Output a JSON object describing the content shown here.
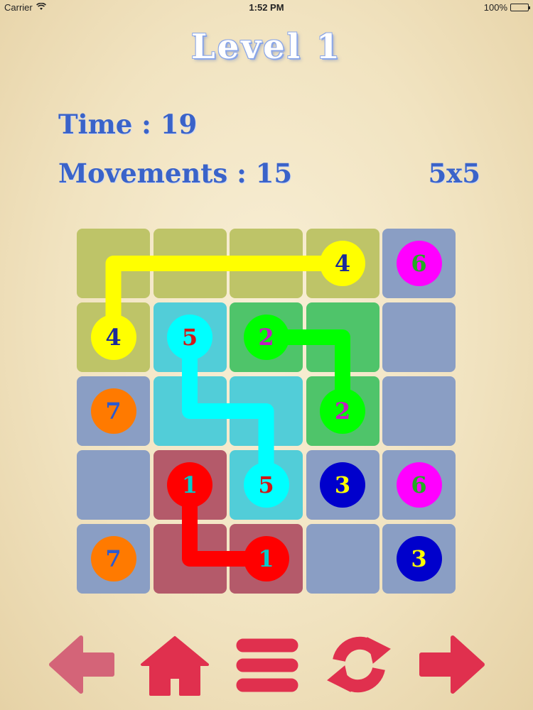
{
  "status_bar": {
    "carrier": "Carrier",
    "time": "1:52 PM",
    "battery": "100%",
    "battery_level": 1.0
  },
  "header": {
    "level": "Level 1",
    "time_label": "Time : 19",
    "movements_label": "Movements : 15",
    "grid_size": "5x5"
  },
  "board": {
    "rows": 5,
    "cols": 5,
    "cell_colors": [
      [
        "#bec468",
        "#bec468",
        "#bec468",
        "#bec468",
        "#8a9ec4"
      ],
      [
        "#bec468",
        "#52cdd8",
        "#4fc46a",
        "#4fc46a",
        "#8a9ec4"
      ],
      [
        "#8a9ec4",
        "#52cdd8",
        "#52cdd8",
        "#4fc46a",
        "#8a9ec4"
      ],
      [
        "#8a9ec4",
        "#b45a6a",
        "#52cdd8",
        "#8a9ec4",
        "#8a9ec4"
      ],
      [
        "#8a9ec4",
        "#b45a6a",
        "#b45a6a",
        "#8a9ec4",
        "#8a9ec4"
      ]
    ],
    "dots": [
      {
        "row": 0,
        "col": 3,
        "number": "4",
        "color": "#ffff00",
        "text_color": "#1a2a9a"
      },
      {
        "row": 0,
        "col": 4,
        "number": "6",
        "color": "#ff00ff",
        "text_color": "#22aa22"
      },
      {
        "row": 1,
        "col": 0,
        "number": "4",
        "color": "#ffff00",
        "text_color": "#1a2a9a"
      },
      {
        "row": 1,
        "col": 1,
        "number": "5",
        "color": "#00ffff",
        "text_color": "#d01818"
      },
      {
        "row": 1,
        "col": 2,
        "number": "2",
        "color": "#00ff00",
        "text_color": "#c020c0"
      },
      {
        "row": 2,
        "col": 0,
        "number": "7",
        "color": "#ff7a00",
        "text_color": "#2a5ad0"
      },
      {
        "row": 2,
        "col": 3,
        "number": "2",
        "color": "#00ff00",
        "text_color": "#c020c0"
      },
      {
        "row": 3,
        "col": 1,
        "number": "1",
        "color": "#ff0000",
        "text_color": "#00cccc"
      },
      {
        "row": 3,
        "col": 2,
        "number": "5",
        "color": "#00ffff",
        "text_color": "#d01818"
      },
      {
        "row": 3,
        "col": 3,
        "number": "3",
        "color": "#0000cc",
        "text_color": "#ffff00"
      },
      {
        "row": 3,
        "col": 4,
        "number": "6",
        "color": "#ff00ff",
        "text_color": "#22aa22"
      },
      {
        "row": 4,
        "col": 0,
        "number": "7",
        "color": "#ff7a00",
        "text_color": "#2a5ad0"
      },
      {
        "row": 4,
        "col": 2,
        "number": "1",
        "color": "#ff0000",
        "text_color": "#00cccc"
      },
      {
        "row": 4,
        "col": 4,
        "number": "3",
        "color": "#0000cc",
        "text_color": "#ffff00"
      }
    ],
    "paths": [
      {
        "color": "#ffff00",
        "cells": [
          [
            0,
            3
          ],
          [
            0,
            0
          ],
          [
            1,
            0
          ]
        ]
      },
      {
        "color": "#00ff00",
        "cells": [
          [
            1,
            2
          ],
          [
            1,
            3
          ],
          [
            2,
            3
          ]
        ]
      },
      {
        "color": "#00ffff",
        "cells": [
          [
            1,
            1
          ],
          [
            2,
            1
          ],
          [
            2,
            2
          ],
          [
            3,
            2
          ]
        ]
      },
      {
        "color": "#ff0000",
        "cells": [
          [
            3,
            1
          ],
          [
            4,
            1
          ],
          [
            4,
            2
          ]
        ]
      }
    ]
  },
  "toolbar": {
    "buttons": [
      {
        "name": "back-button",
        "icon": "arrow-left-icon",
        "color": "#d46478"
      },
      {
        "name": "home-button",
        "icon": "home-icon",
        "color": "#e0304e"
      },
      {
        "name": "menu-button",
        "icon": "menu-icon",
        "color": "#e0304e"
      },
      {
        "name": "restart-button",
        "icon": "refresh-icon",
        "color": "#e0304e"
      },
      {
        "name": "next-button",
        "icon": "arrow-right-icon",
        "color": "#e0304e"
      }
    ]
  }
}
